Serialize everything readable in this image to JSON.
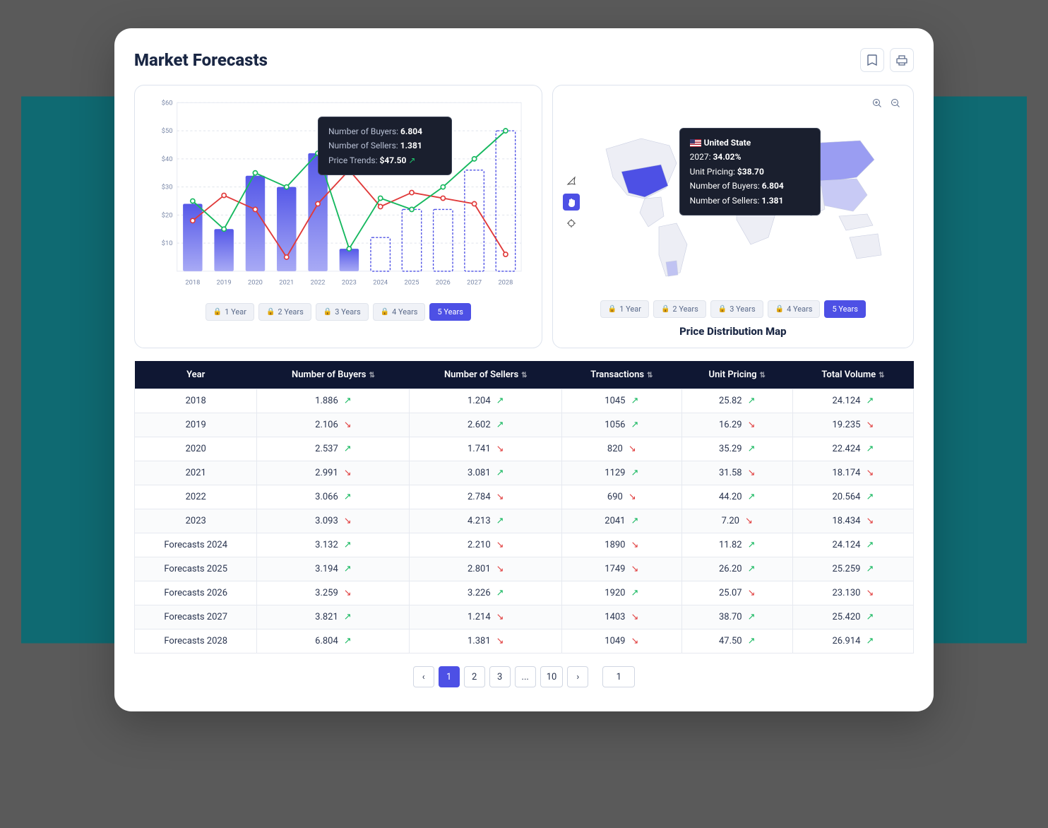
{
  "title": "Market Forecasts",
  "chart_data": {
    "type": "bar+line",
    "bars_actual": {
      "categories": [
        "2018",
        "2019",
        "2020",
        "2021",
        "2022",
        "2023"
      ],
      "values": [
        24,
        15,
        34,
        30,
        42,
        8
      ]
    },
    "bars_forecast": {
      "categories": [
        "2024",
        "2025",
        "2026",
        "2027",
        "2028"
      ],
      "values": [
        12,
        22,
        22,
        36,
        50
      ]
    },
    "series": [
      {
        "name": "Number of Sellers",
        "color": "#e03a3a",
        "x": [
          "2018",
          "2019",
          "2020",
          "2021",
          "2022",
          "2023",
          "2024",
          "2025",
          "2026",
          "2027",
          "2028"
        ],
        "y": [
          18,
          27,
          22,
          5,
          24,
          36,
          23,
          28,
          26,
          24,
          6
        ]
      },
      {
        "name": "Number of Buyers",
        "color": "#16b85f",
        "x": [
          "2018",
          "2019",
          "2020",
          "2021",
          "2022",
          "2023",
          "2024",
          "2025",
          "2026",
          "2027",
          "2028"
        ],
        "y": [
          25,
          15,
          35,
          30,
          42,
          8,
          26,
          22,
          30,
          40,
          50
        ]
      }
    ],
    "ylim": [
      0,
      60
    ],
    "yticks": [
      10,
      20,
      30,
      40,
      50,
      60
    ],
    "tooltip": {
      "buyers_label": "Number of Buyers:",
      "buyers_val": "6.804",
      "sellers_label": "Number of Sellers:",
      "sellers_val": "1.381",
      "price_label": "Price Trends:",
      "price_val": "$47.50"
    },
    "time_filters": [
      "1 Year",
      "2 Years",
      "3 Years",
      "4 Years",
      "5 Years"
    ],
    "time_active": 4
  },
  "map": {
    "title": "Price Distribution Map",
    "time_filters": [
      "1 Year",
      "2 Years",
      "3 Years",
      "4 Years",
      "5 Years"
    ],
    "time_active": 4,
    "tooltip": {
      "country": "United State",
      "year": "2027:",
      "pct": "34.02%",
      "unit_label": "Unit Pricing:",
      "unit_val": "$38.70",
      "buyers_label": "Number of Buyers:",
      "buyers_val": "6.804",
      "sellers_label": "Number of Sellers:",
      "sellers_val": "1.381"
    }
  },
  "table": {
    "headers": [
      "Year",
      "Number of Buyers",
      "Number of Sellers",
      "Transactions",
      "Unit Pricing",
      "Total Volume"
    ],
    "rows": [
      {
        "year": "2018",
        "buyers": "1.886",
        "buyers_t": "up",
        "sellers": "1.204",
        "sellers_t": "up",
        "trans": "1045",
        "trans_t": "up",
        "unit": "25.82",
        "unit_t": "up",
        "vol": "24.124",
        "vol_t": "up"
      },
      {
        "year": "2019",
        "buyers": "2.106",
        "buyers_t": "down",
        "sellers": "2.602",
        "sellers_t": "up",
        "trans": "1056",
        "trans_t": "up",
        "unit": "16.29",
        "unit_t": "down",
        "vol": "19.235",
        "vol_t": "down"
      },
      {
        "year": "2020",
        "buyers": "2.537",
        "buyers_t": "up",
        "sellers": "1.741",
        "sellers_t": "down",
        "trans": "820",
        "trans_t": "down",
        "unit": "35.29",
        "unit_t": "up",
        "vol": "22.424",
        "vol_t": "up"
      },
      {
        "year": "2021",
        "buyers": "2.991",
        "buyers_t": "down",
        "sellers": "3.081",
        "sellers_t": "up",
        "trans": "1129",
        "trans_t": "up",
        "unit": "31.58",
        "unit_t": "down",
        "vol": "18.174",
        "vol_t": "down"
      },
      {
        "year": "2022",
        "buyers": "3.066",
        "buyers_t": "up",
        "sellers": "2.784",
        "sellers_t": "down",
        "trans": "690",
        "trans_t": "down",
        "unit": "44.20",
        "unit_t": "up",
        "vol": "20.564",
        "vol_t": "up"
      },
      {
        "year": "2023",
        "buyers": "3.093",
        "buyers_t": "down",
        "sellers": "4.213",
        "sellers_t": "up",
        "trans": "2041",
        "trans_t": "up",
        "unit": "7.20",
        "unit_t": "down",
        "vol": "18.434",
        "vol_t": "down"
      },
      {
        "year": "Forecasts 2024",
        "buyers": "3.132",
        "buyers_t": "up",
        "sellers": "2.210",
        "sellers_t": "down",
        "trans": "1890",
        "trans_t": "down",
        "unit": "11.82",
        "unit_t": "up",
        "vol": "24.124",
        "vol_t": "up"
      },
      {
        "year": "Forecasts 2025",
        "buyers": "3.194",
        "buyers_t": "up",
        "sellers": "2.801",
        "sellers_t": "down",
        "trans": "1749",
        "trans_t": "down",
        "unit": "26.20",
        "unit_t": "up",
        "vol": "25.259",
        "vol_t": "up"
      },
      {
        "year": "Forecasts 2026",
        "buyers": "3.259",
        "buyers_t": "down",
        "sellers": "3.226",
        "sellers_t": "up",
        "trans": "1920",
        "trans_t": "up",
        "unit": "25.07",
        "unit_t": "down",
        "vol": "23.130",
        "vol_t": "down"
      },
      {
        "year": "Forecasts 2027",
        "buyers": "3.821",
        "buyers_t": "up",
        "sellers": "1.214",
        "sellers_t": "down",
        "trans": "1403",
        "trans_t": "down",
        "unit": "38.70",
        "unit_t": "up",
        "vol": "25.420",
        "vol_t": "up"
      },
      {
        "year": "Forecasts 2028",
        "buyers": "6.804",
        "buyers_t": "up",
        "sellers": "1.381",
        "sellers_t": "down",
        "trans": "1049",
        "trans_t": "down",
        "unit": "47.50",
        "unit_t": "up",
        "vol": "26.914",
        "vol_t": "up"
      }
    ]
  },
  "pagination": {
    "pages": [
      "1",
      "2",
      "3",
      "...",
      "10"
    ],
    "active": 0,
    "goto": "1"
  }
}
